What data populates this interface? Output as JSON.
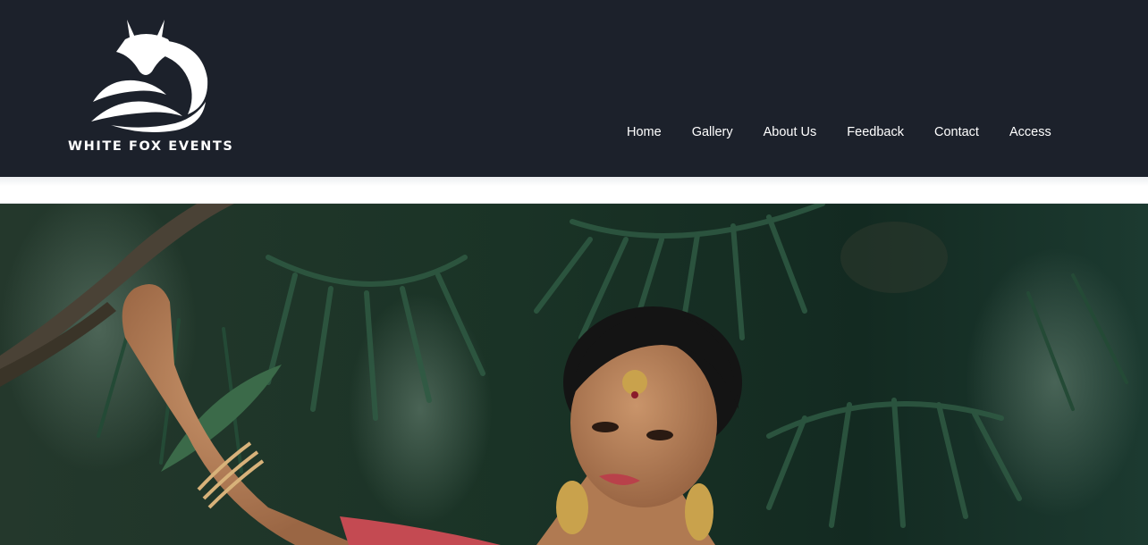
{
  "brand": {
    "name": "WHITE FOX EVENTS",
    "logo_icon": "fox-logo-icon"
  },
  "nav": {
    "items": [
      {
        "label": "Home"
      },
      {
        "label": "Gallery"
      },
      {
        "label": "About Us"
      },
      {
        "label": "Feedback"
      },
      {
        "label": "Contact"
      },
      {
        "label": "Access"
      }
    ]
  },
  "hero": {
    "image": "bride-portrait-image"
  },
  "colors": {
    "header_bg": "#1c212b",
    "nav_text": "#ffffff",
    "hero_foliage": "#1d3a2c"
  }
}
